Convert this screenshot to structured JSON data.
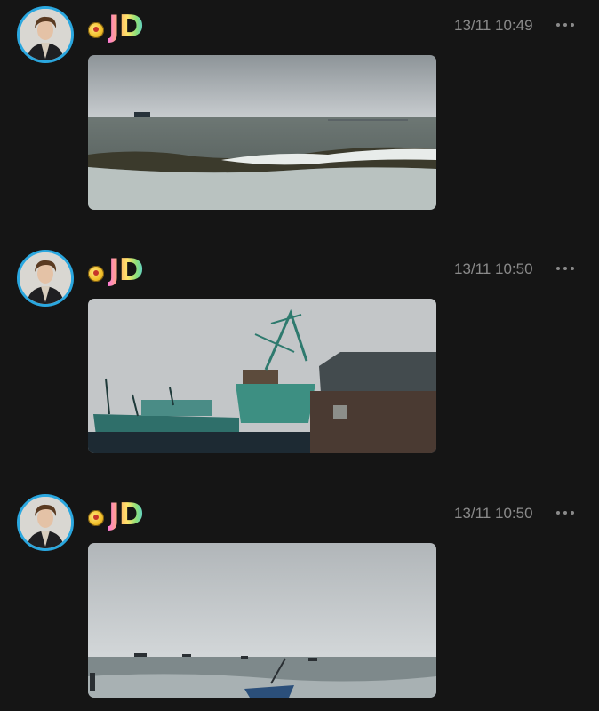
{
  "posts": [
    {
      "username": "JD",
      "timestamp": "13/11 10:49",
      "photo": "sea-waves-photo",
      "avatar_icon": "profile-avatar",
      "badge_icon": "gold-badge-icon",
      "more_icon": "more-options-icon"
    },
    {
      "username": "JD",
      "timestamp": "13/11 10:50",
      "photo": "fishing-boats-photo",
      "avatar_icon": "profile-avatar",
      "badge_icon": "gold-badge-icon",
      "more_icon": "more-options-icon"
    },
    {
      "username": "JD",
      "timestamp": "13/11 10:50",
      "photo": "boats-at-sea-photo",
      "avatar_icon": "profile-avatar",
      "badge_icon": "gold-badge-icon",
      "more_icon": "more-options-icon"
    }
  ],
  "colors": {
    "background": "#151515",
    "avatar_ring": "#2aa7df",
    "timestamp_text": "#8a8a8a"
  }
}
